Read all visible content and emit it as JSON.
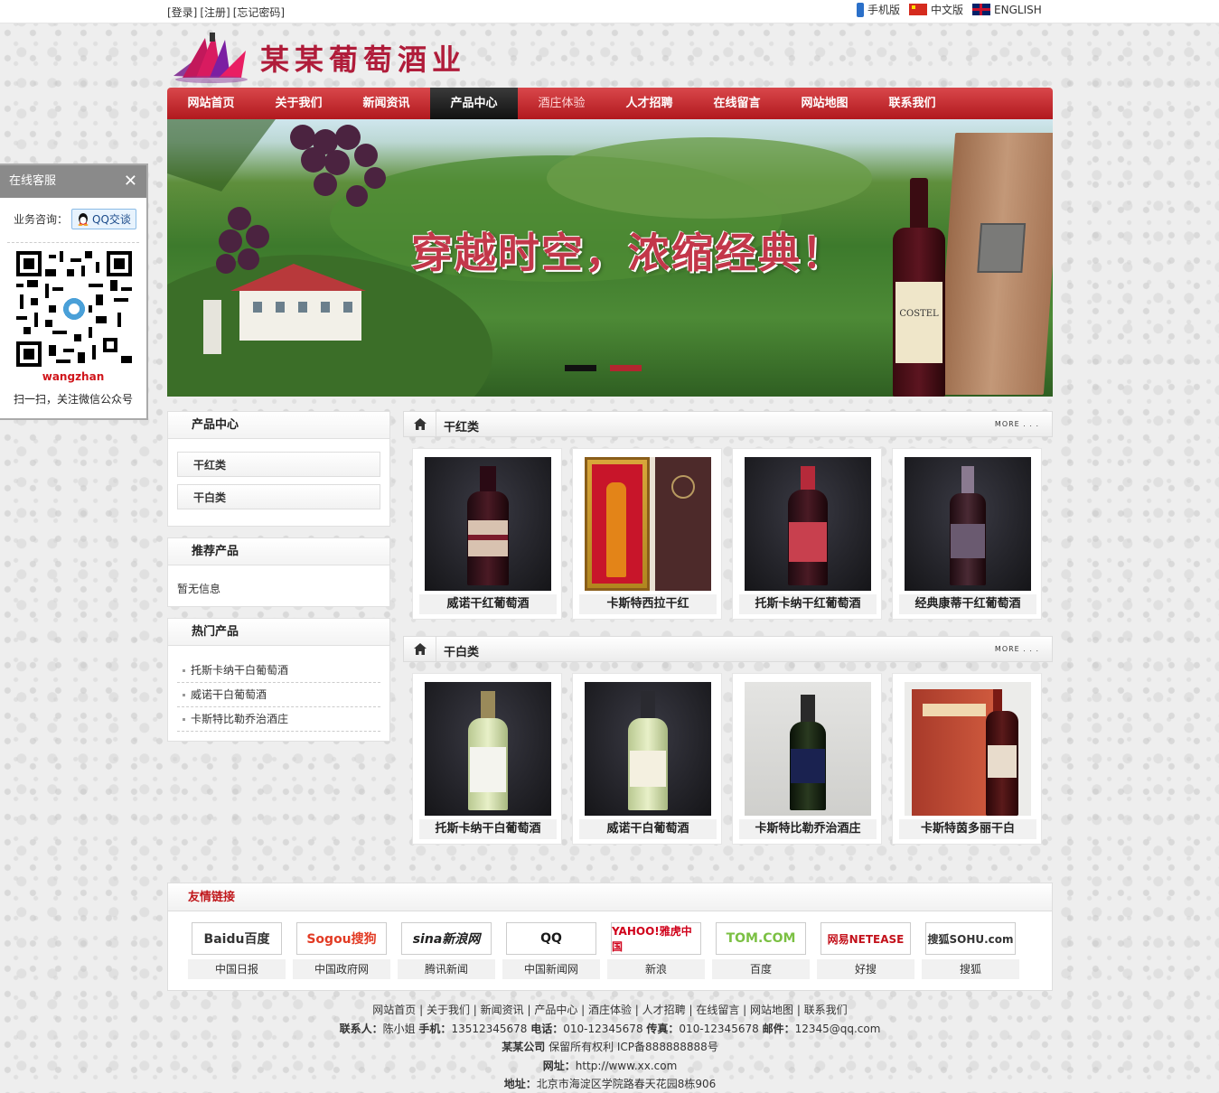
{
  "top": {
    "login": "[登录]",
    "register": "[注册]",
    "forgot": "[忘记密码]",
    "mobile": "手机版",
    "chinese": "中文版",
    "english": "ENGLISH"
  },
  "logo": {
    "title": "某某葡萄酒业"
  },
  "nav": [
    {
      "label": "网站首页"
    },
    {
      "label": "关于我们"
    },
    {
      "label": "新闻资讯"
    },
    {
      "label": "产品中心"
    },
    {
      "label": "酒庄体验"
    },
    {
      "label": "人才招聘"
    },
    {
      "label": "在线留言"
    },
    {
      "label": "网站地图"
    },
    {
      "label": "联系我们"
    }
  ],
  "banner": {
    "slogan": "穿越时空，浓缩经典！",
    "bottle_label": "COSTEL"
  },
  "service": {
    "title": "在线客服",
    "consult_label": "业务咨询：",
    "qq_label": "QQ交谈",
    "qr_name": "wangzhan",
    "qr_tip": "扫一扫，关注微信公众号"
  },
  "sidebar": {
    "product_center": {
      "title": "产品中心",
      "items": [
        "干红类",
        "干白类"
      ]
    },
    "recommend": {
      "title": "推荐产品",
      "empty": "暂无信息"
    },
    "hot": {
      "title": "热门产品",
      "items": [
        "托斯卡纳干白葡萄酒",
        "威诺干白葡萄酒",
        "卡斯特比勒乔治酒庄"
      ]
    }
  },
  "sections": [
    {
      "title": "干红类",
      "more": "MORE . . .",
      "products": [
        "威诺干红葡萄酒",
        "卡斯特西拉干红",
        "托斯卡纳干红葡萄酒",
        "经典康蒂干红葡萄酒"
      ]
    },
    {
      "title": "干白类",
      "more": "MORE . . .",
      "products": [
        "托斯卡纳干白葡萄酒",
        "威诺干白葡萄酒",
        "卡斯特比勒乔治酒庄",
        "卡斯特茵多丽干白"
      ]
    }
  ],
  "links": {
    "title": "友情链接",
    "items": [
      {
        "logo": "Baidu百度",
        "name": "中国日报"
      },
      {
        "logo": "Sogou搜狗",
        "name": "中国政府网"
      },
      {
        "logo": "sina新浪网",
        "name": "腾讯新闻"
      },
      {
        "logo": "QQ",
        "name": "中国新闻网"
      },
      {
        "logo": "YAHOO!雅虎中国",
        "name": "新浪"
      },
      {
        "logo": "TOM.COM",
        "name": "百度"
      },
      {
        "logo": "网易NETEASE",
        "name": "好搜"
      },
      {
        "logo": "搜狐SOHU.com",
        "name": "搜狐"
      }
    ]
  },
  "footer": {
    "nav": "网站首页 | 关于我们 | 新闻资讯 | 产品中心 | 酒庄体验 | 人才招聘 | 在线留言 | 网站地图 | 联系我们",
    "contact_label": "联系人：",
    "contact": "陈小姐",
    "mobile_label": "手机：",
    "mobile": "13512345678",
    "phone_label": "电话：",
    "phone": "010-12345678",
    "fax_label": "传真：",
    "fax": "010-12345678",
    "email_label": "邮件：",
    "email": "12345@qq.com",
    "company": "某某公司",
    "rights": "保留所有权利 ICP备888888888号",
    "site_label": "网址：",
    "site": "http://www.xx.com",
    "address_label": "地址：",
    "address": "北京市海淀区学院路春天花园8栋906"
  },
  "colors": {
    "brand_red": "#c0181c",
    "nav_dark": "#1a1a1a"
  }
}
